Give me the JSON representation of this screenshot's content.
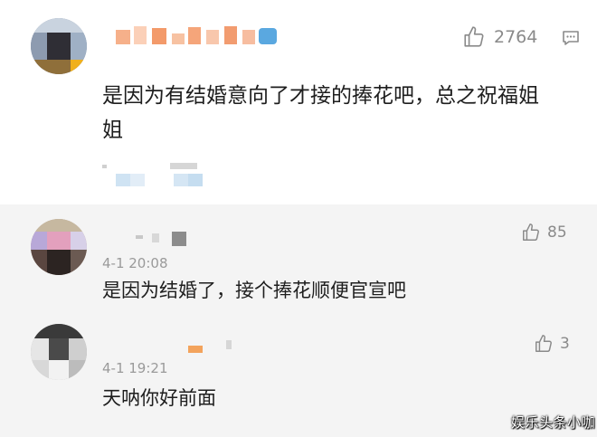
{
  "main_comment": {
    "like_count": "2764",
    "text_line1": "是因为有结婚意向了才接的捧花吧，总之祝福姐",
    "text_line2": "姐"
  },
  "replies": [
    {
      "like_count": "85",
      "time": "4-1 20:08",
      "text": "是因为结婚了，接个捧花顺便官宣吧"
    },
    {
      "like_count": "3",
      "time": "4-1 19:21",
      "text": "天呐你好前面"
    }
  ],
  "watermark": "娱乐头条小咖"
}
